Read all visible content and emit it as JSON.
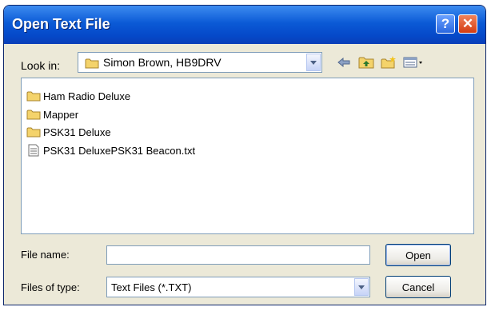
{
  "dialog": {
    "title": "Open Text File",
    "help_glyph": "?",
    "close_glyph": "✕"
  },
  "look_in": {
    "label": "Look in:",
    "value": "Simon Brown, HB9DRV",
    "icon": "folder-icon"
  },
  "toolbar": {
    "icons": [
      "back-arrow-icon",
      "up-folder-icon",
      "new-folder-icon",
      "view-menu-icon"
    ]
  },
  "files": [
    {
      "name": "Ham Radio Deluxe",
      "icon": "folder-icon"
    },
    {
      "name": "Mapper",
      "icon": "folder-icon"
    },
    {
      "name": "PSK31 Deluxe",
      "icon": "folder-icon"
    },
    {
      "name": "PSK31 DeluxePSK31 Beacon.txt",
      "icon": "text-file-icon"
    }
  ],
  "file_name": {
    "label": "File name:",
    "value": ""
  },
  "file_type": {
    "label": "Files of type:",
    "value": "Text Files (*.TXT)"
  },
  "buttons": {
    "open": "Open",
    "cancel": "Cancel"
  },
  "colors": {
    "title_bar": "#0b5ad6",
    "dialog_bg": "#ece9d8",
    "folder": "#f4d36b",
    "close_button": "#d43c12"
  }
}
